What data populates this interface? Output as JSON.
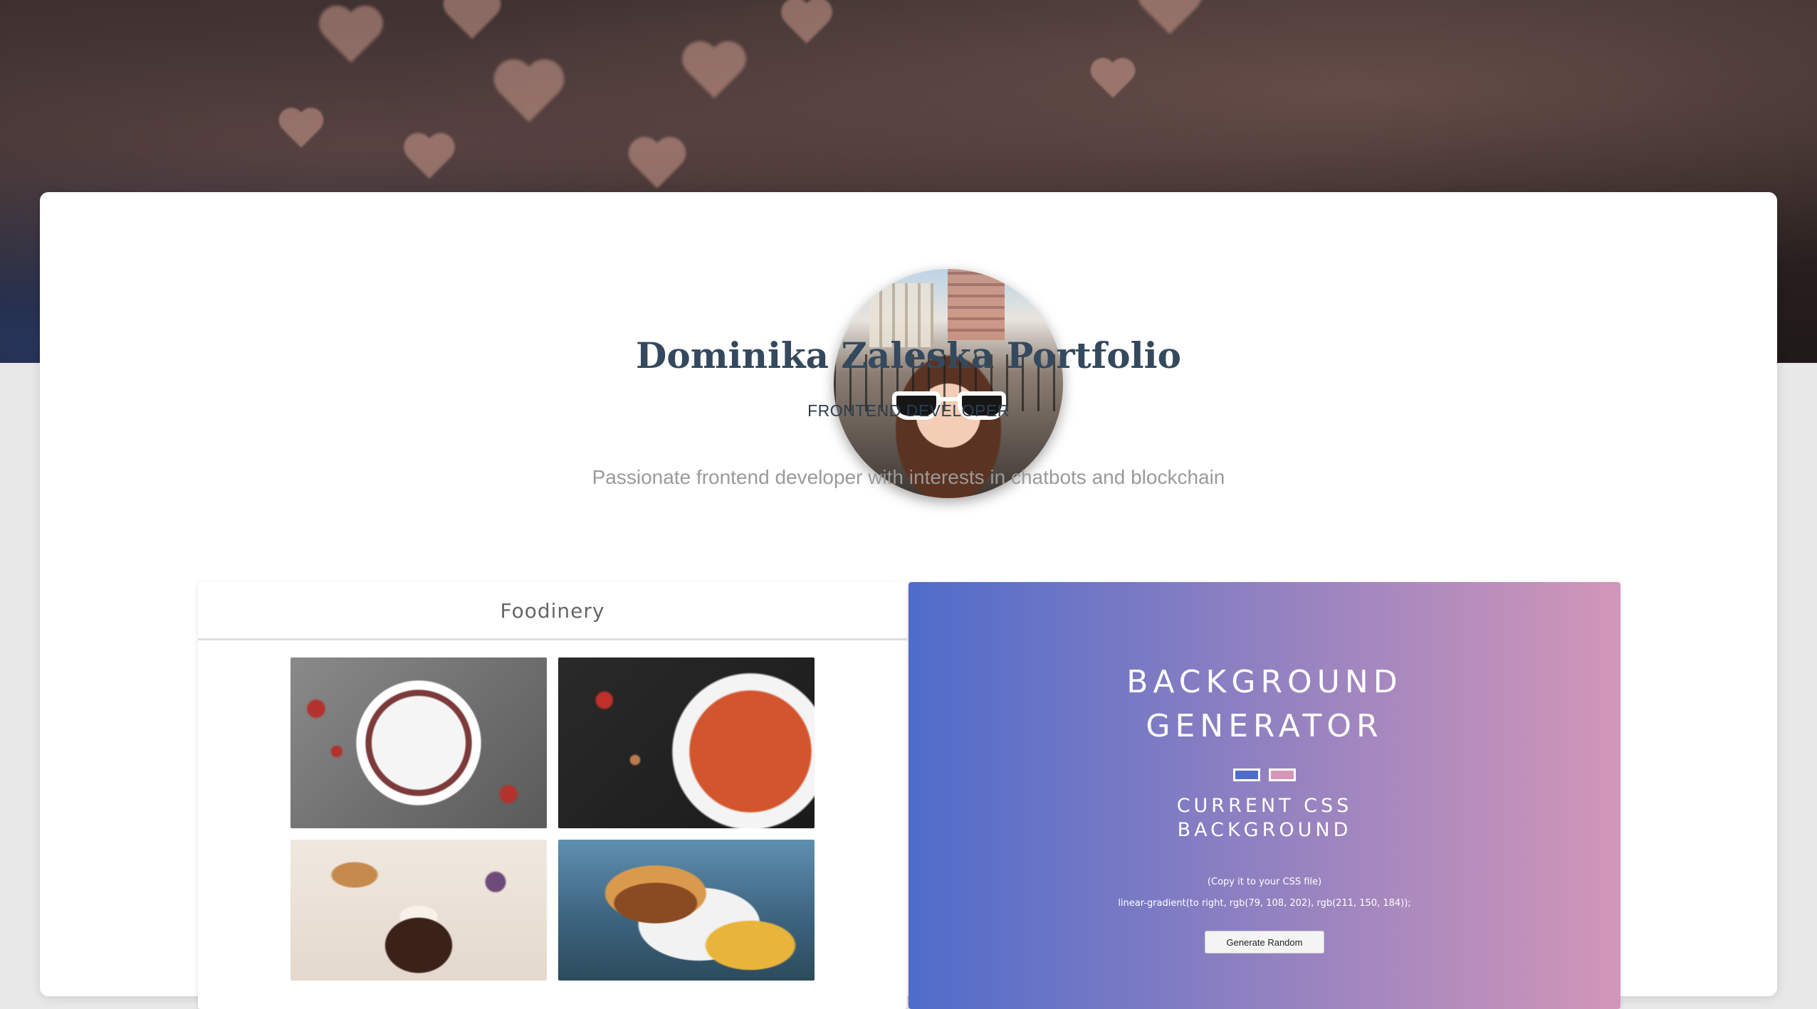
{
  "profile": {
    "name": "Dominika Zaleska Portfolio",
    "role": "FRONTEND DEVELOPER",
    "bio": "Passionate frontend developer with interests in chatbots and blockchain"
  },
  "projects": [
    {
      "title": "Foodinery"
    },
    {
      "title_line1": "BACKGROUND",
      "title_line2": "GENERATOR",
      "subtitle_line1": "CURRENT CSS",
      "subtitle_line2": "BACKGROUND",
      "copy_hint": "(Copy it to your CSS file)",
      "css_value": "linear-gradient(to right, rgb(79, 108, 202), rgb(211, 150, 184));",
      "button_label": "Generate Random",
      "color1": "#4f6cca",
      "color2": "#d396b8"
    }
  ],
  "colors": {
    "title": "#34495e",
    "text_muted": "#9a9a9a",
    "card_bg": "#ffffff",
    "page_bg": "#e8e8e8"
  }
}
